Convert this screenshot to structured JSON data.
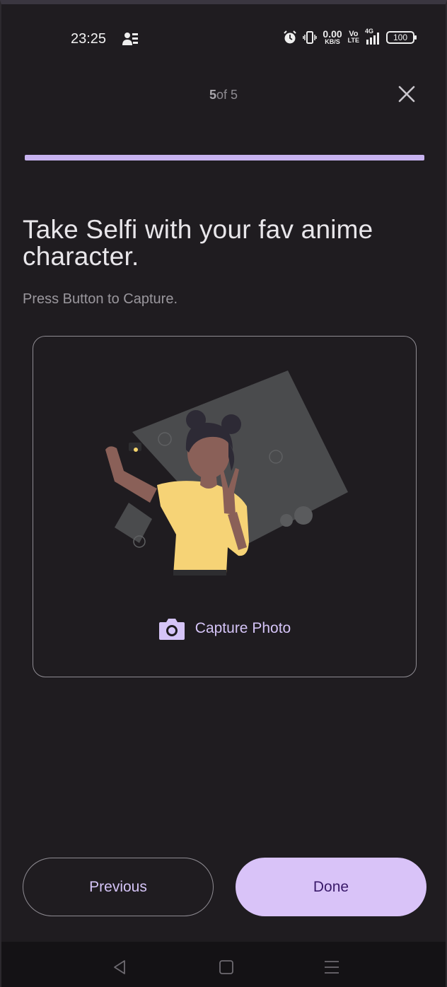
{
  "status_bar": {
    "time": "23:25",
    "net_speed_value": "0.00",
    "net_speed_unit": "KB/S",
    "volte_top": "Vo",
    "volte_bottom": "LTE",
    "signal_label": "4G",
    "battery": "100",
    "icons": [
      "people-icon",
      "alarm-icon",
      "vibrate-icon",
      "signal-icon",
      "battery-icon"
    ]
  },
  "header": {
    "step_current": "5",
    "step_rest": "of 5",
    "progress": 1.0,
    "close_icon": "close-icon"
  },
  "content": {
    "title": "Take Selfi with your fav anime character.",
    "subtitle": "Press Button to Capture.",
    "capture_label": "Capture Photo",
    "capture_icon": "camera-icon"
  },
  "footer": {
    "previous_label": "Previous",
    "done_label": "Done"
  },
  "navbar": {
    "icons": [
      "back-icon",
      "home-icon",
      "menu-icon"
    ]
  },
  "colors": {
    "background": "#1f1c20",
    "accent": "#d9c3f8",
    "progress": "#c8b3f0",
    "text_primary": "#e8e6ea",
    "text_secondary": "#9a979d"
  }
}
